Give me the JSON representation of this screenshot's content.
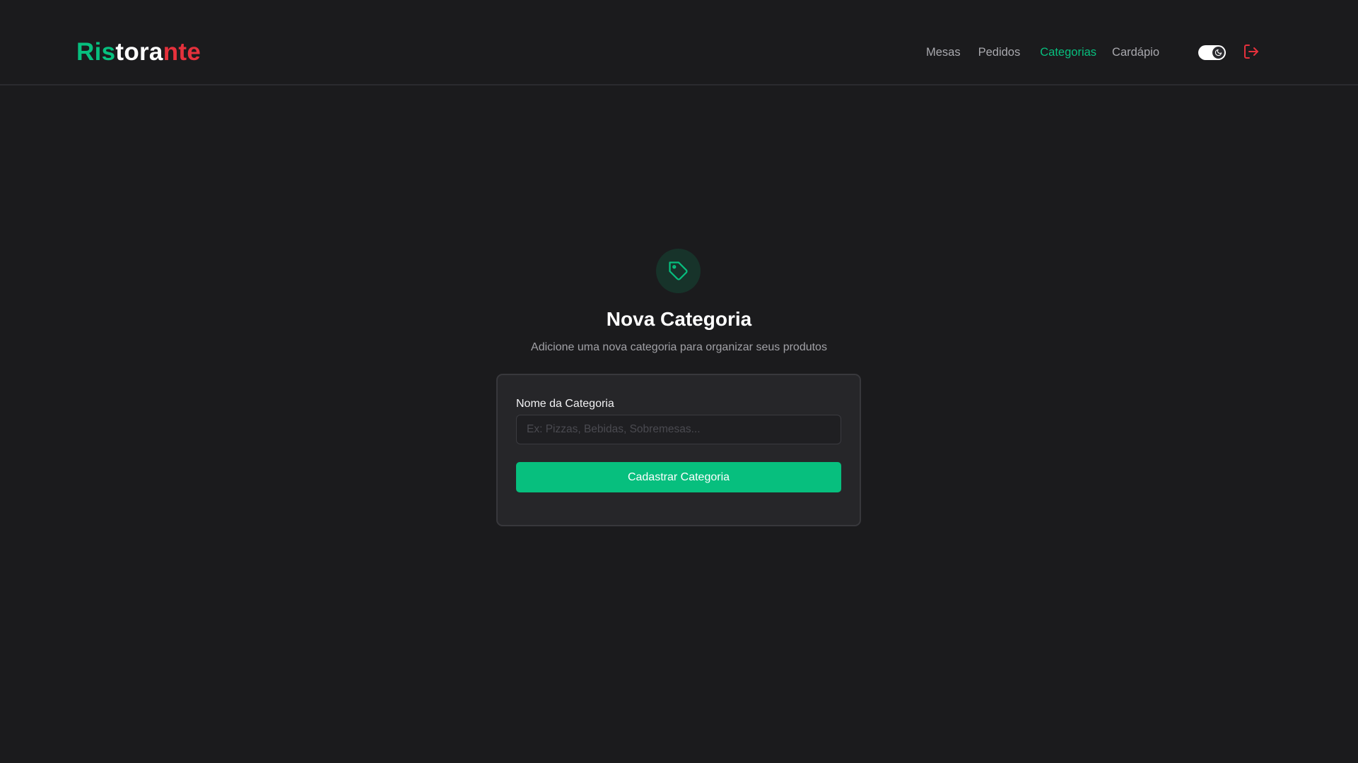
{
  "brand": {
    "part1": "Ris",
    "part2": "tora",
    "part3": "nte",
    "colors": {
      "part1": "#07bf7e",
      "part2": "#ffffff",
      "part3": "#e5313c"
    }
  },
  "nav": {
    "items": [
      {
        "label": "Mesas",
        "active": false
      },
      {
        "label": "Pedidos",
        "active": false
      },
      {
        "label": "Categorias",
        "active": true
      },
      {
        "label": "Cardápio",
        "active": false
      }
    ],
    "theme_toggle": {
      "icon": "moon-icon",
      "state": "dark"
    },
    "logout_icon": "logout-icon"
  },
  "hero": {
    "icon": "tag-icon",
    "title": "Nova Categoria",
    "subtitle": "Adicione uma nova categoria para organizar seus produtos"
  },
  "form": {
    "label": "Nome da Categoria",
    "input_value": "",
    "input_placeholder": "Ex: Pizzas, Bebidas, Sobremesas...",
    "submit_label": "Cadastrar Categoria"
  },
  "colors": {
    "accent": "#07bf7e",
    "danger": "#e5313c",
    "background": "#1b1b1d",
    "card": "#262629"
  }
}
